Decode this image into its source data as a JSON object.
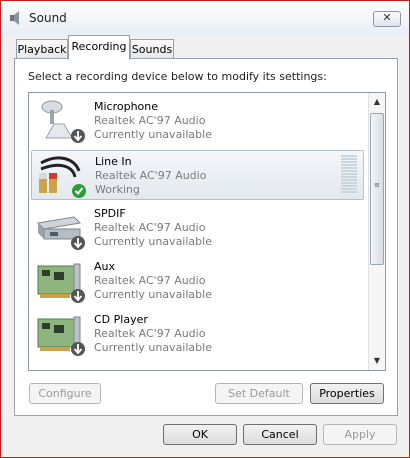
{
  "window": {
    "title": "Sound",
    "close_glyph": "✕"
  },
  "tabs": [
    {
      "label": "Playback",
      "active": false
    },
    {
      "label": "Recording",
      "active": true
    },
    {
      "label": "Sounds",
      "active": false
    }
  ],
  "instruction": "Select a recording device below to modify its settings:",
  "devices": [
    {
      "name": "Microphone",
      "driver": "Realtek AC'97 Audio",
      "status": "Currently unavailable",
      "icon": "microphone-icon",
      "badge": "down-arrow-badge"
    },
    {
      "name": "Line In",
      "driver": "Realtek AC'97 Audio",
      "status": "Working",
      "icon": "rca-cable-icon",
      "badge": "green-check-badge",
      "selected": true
    },
    {
      "name": "SPDIF",
      "driver": "Realtek AC'97 Audio",
      "status": "Currently unavailable",
      "icon": "spdif-device-icon",
      "badge": "down-arrow-badge"
    },
    {
      "name": "Aux",
      "driver": "Realtek AC'97 Audio",
      "status": "Currently unavailable",
      "icon": "circuit-card-icon",
      "badge": "down-arrow-badge"
    },
    {
      "name": "CD Player",
      "driver": "Realtek AC'97 Audio",
      "status": "Currently unavailable",
      "icon": "circuit-card-icon",
      "badge": "down-arrow-badge"
    }
  ],
  "panel_buttons": {
    "configure": "Configure",
    "set_default": "Set Default",
    "properties": "Properties"
  },
  "dialog_buttons": {
    "ok": "OK",
    "cancel": "Cancel",
    "apply": "Apply"
  },
  "colors": {
    "window_border": "#cc1a1a",
    "badge_green": "#2e9c3a",
    "badge_gray": "#555555"
  }
}
